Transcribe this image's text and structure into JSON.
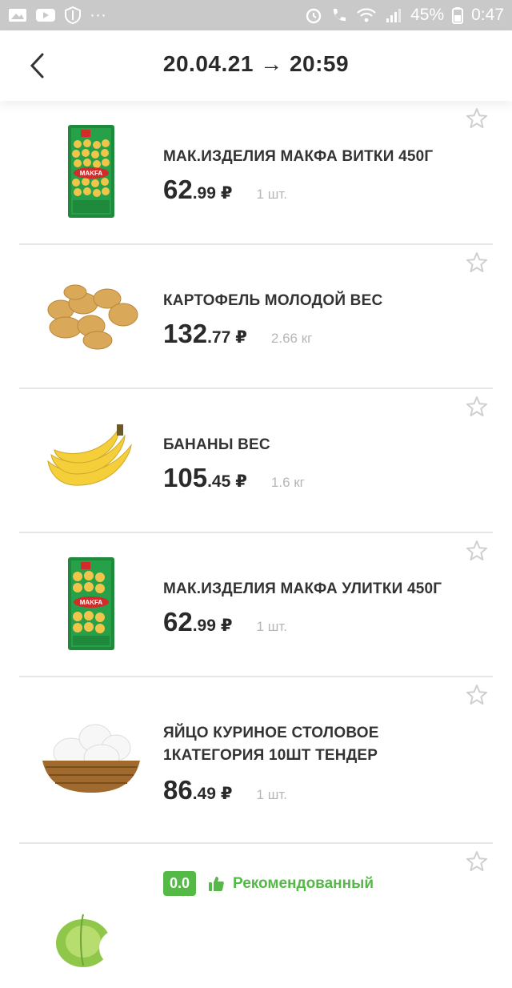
{
  "status_bar": {
    "icons_left": [
      "gallery-icon",
      "youtube-icon",
      "shield-icon",
      "more-icon"
    ],
    "more_glyph": "···",
    "battery_percent": "45%",
    "time": "0:47"
  },
  "header": {
    "title": "20.04.21 → 20:59"
  },
  "items": [
    {
      "name": "МАК.ИЗДЕЛИЯ МАКФА ВИТКИ 450Г",
      "price_int": "62",
      "price_dec": ".99",
      "currency": "₽",
      "qty": "1 шт.",
      "image": "makfa-pasta"
    },
    {
      "name": "КАРТОФЕЛЬ МОЛОДОЙ ВЕС",
      "price_int": "132",
      "price_dec": ".77",
      "currency": "₽",
      "qty": "2.66 кг",
      "image": "potatoes"
    },
    {
      "name": "БАНАНЫ ВЕС",
      "price_int": "105",
      "price_dec": ".45",
      "currency": "₽",
      "qty": "1.6 кг",
      "image": "bananas"
    },
    {
      "name": "МАК.ИЗДЕЛИЯ МАКФА УЛИТКИ 450Г",
      "price_int": "62",
      "price_dec": ".99",
      "currency": "₽",
      "qty": "1 шт.",
      "image": "makfa-pasta"
    },
    {
      "name": "ЯЙЦО КУРИНОЕ СТОЛОВОЕ 1КАТЕГОРИЯ 10ШТ ТЕНДЕР",
      "price_int": "86",
      "price_dec": ".49",
      "currency": "₽",
      "qty": "1 шт.",
      "image": "eggs"
    },
    {
      "rating": "0.0",
      "recommend_label": "Рекомендованный",
      "image": "cabbage"
    }
  ],
  "brand": {
    "makfa_label": "MAKFA"
  },
  "colors": {
    "accent_green": "#55b947",
    "status_bar": "#c9c9c9"
  }
}
